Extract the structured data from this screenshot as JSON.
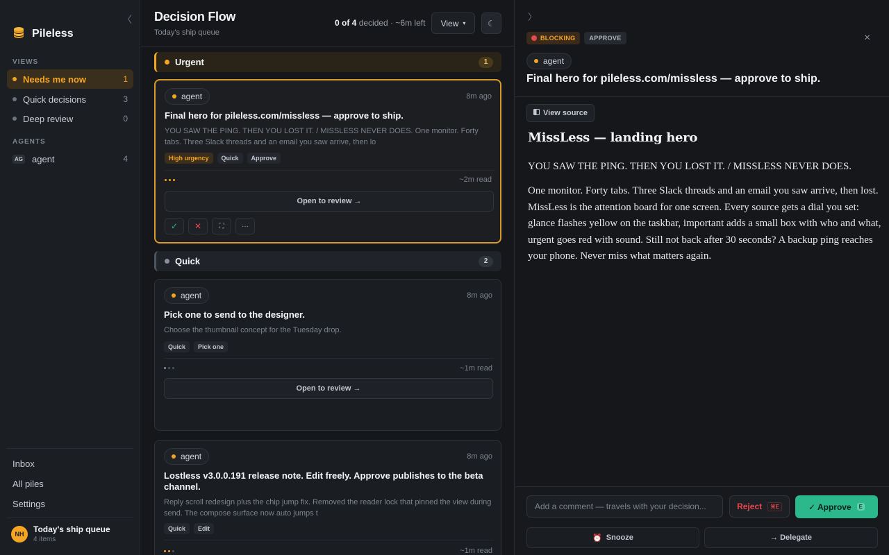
{
  "sidebar": {
    "collapse_icon": "chevron-left",
    "app_name": "Pileless",
    "views_label": "VIEWS",
    "views": [
      {
        "label": "Needs me now",
        "count": "1",
        "active": true
      },
      {
        "label": "Quick decisions",
        "count": "3"
      },
      {
        "label": "Deep review",
        "count": "0"
      }
    ],
    "agents_label": "AGENTS",
    "agents": [
      {
        "badge": "AG",
        "label": "agent",
        "count": "4"
      }
    ],
    "links": [
      "Inbox",
      "All piles",
      "Settings"
    ],
    "user": {
      "initials": "NH",
      "title": "Today's ship queue",
      "subtitle": "4 items"
    }
  },
  "header": {
    "title": "Decision Flow",
    "subtitle": "Today's ship queue",
    "progress_decided": "0 of 4",
    "progress_rest": "decided · ~6m left",
    "view_label": "View",
    "view_caret": "▾",
    "theme_icon": "☾"
  },
  "groups": {
    "urgent": {
      "label": "Urgent",
      "count": "1",
      "color": "#f5a524"
    },
    "quick": {
      "label": "Quick",
      "count": "2",
      "color": "#8a9099"
    }
  },
  "cards": [
    {
      "agent": "agent",
      "time": "8m ago",
      "title": "Final hero for pileless.com/missless — approve to ship.",
      "desc": "YOU SAW THE PING. THEN YOU LOST IT. / MISSLESS NEVER DOES. One monitor. Forty tabs. Three Slack threads and an email you saw arrive, then lo",
      "tags": [
        "High urgency",
        "Quick",
        "Approve"
      ],
      "read": "~2m read",
      "open": "Open to review →",
      "actions": [
        "✓",
        "✕",
        "⛶",
        "···"
      ]
    },
    {
      "agent": "agent",
      "time": "8m ago",
      "title": "Pick one to send to the designer.",
      "desc": "Choose the thumbnail concept for the Tuesday drop.",
      "tags": [
        "Quick",
        "Pick one"
      ],
      "read": "~1m read",
      "open": "Open to review →"
    },
    {
      "agent": "agent",
      "time": "8m ago",
      "title": "Lostless v3.0.0.191 release note. Edit freely. Approve publishes to the beta channel.",
      "desc": "Reply scroll redesign plus the chip jump fix. Removed the reader lock that pinned the view during send. The compose surface now auto jumps t",
      "tags": [
        "Quick",
        "Edit"
      ],
      "read": "~1m read"
    }
  ],
  "panel": {
    "expand_icon": "chevron-right",
    "close_icon": "×",
    "badges": [
      "BLOCKING",
      "APPROVE"
    ],
    "agent": "agent",
    "title": "Final hero for pileless.com/missless — approve to ship.",
    "view_source": "View source",
    "doc_heading": "MissLess — landing hero",
    "doc_p1": "YOU SAW THE PING. THEN YOU LOST IT. / MISSLESS NEVER DOES.",
    "doc_p2": "One monitor. Forty tabs. Three Slack threads and an email you saw arrive, then lost. MissLess is the attention board for one screen. Every source gets a dial you set: glance flashes yellow on the taskbar, important adds a small box with who and what, urgent goes red with sound. Still not back after 30 seconds? A backup ping reaches your phone. Never miss what matters again.",
    "comment_placeholder": "Add a comment — travels with your decision...",
    "reject_label": "Reject",
    "reject_kbd": "⌘E",
    "approve_label": "✓ Approve",
    "approve_kbd": "E",
    "snooze_label": "Snooze",
    "snooze_icon": "⏰",
    "delegate_label": "→ Delegate"
  },
  "colors": {
    "accent": "#f5a524",
    "approve": "#2bb88a",
    "reject": "#e5484d",
    "background": "#15171b"
  }
}
